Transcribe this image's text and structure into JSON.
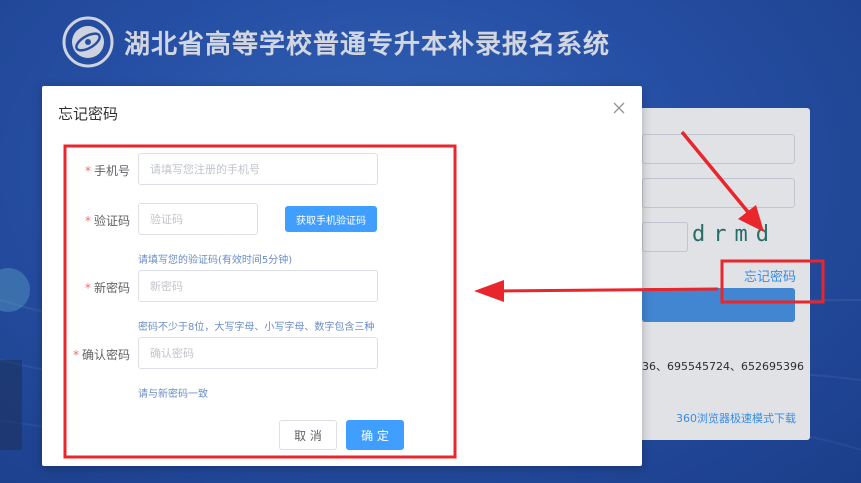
{
  "header": {
    "title": "湖北省高等学校普通专升本补录报名系统",
    "logo_icon": "school-seal-icon"
  },
  "login_panel": {
    "captcha_text": "drmd",
    "forgot_link": "忘记密码",
    "phones_text": "36、695545724、652695396",
    "browser_link": "360浏览器极速模式下载"
  },
  "dialog": {
    "title": "忘记密码",
    "phone": {
      "label": "手机号",
      "placeholder": "请填写您注册的手机号"
    },
    "code": {
      "label": "验证码",
      "placeholder": "验证码",
      "button": "获取手机验证码",
      "hint": "请填写您的验证码(有效时间5分钟)"
    },
    "new_password": {
      "label": "新密码",
      "placeholder": "新密码",
      "hint": "密码不少于8位，大写字母、小写字母、数字包含三种"
    },
    "confirm_password": {
      "label": "确认密码",
      "placeholder": "确认密码",
      "hint": "请与新密码一致"
    },
    "cancel_label": "取 消",
    "ok_label": "确 定"
  },
  "colors": {
    "primary": "#409eff",
    "annotation_red": "#e8262c",
    "required_star": "#f56c6c",
    "background": "#2a58b4"
  }
}
